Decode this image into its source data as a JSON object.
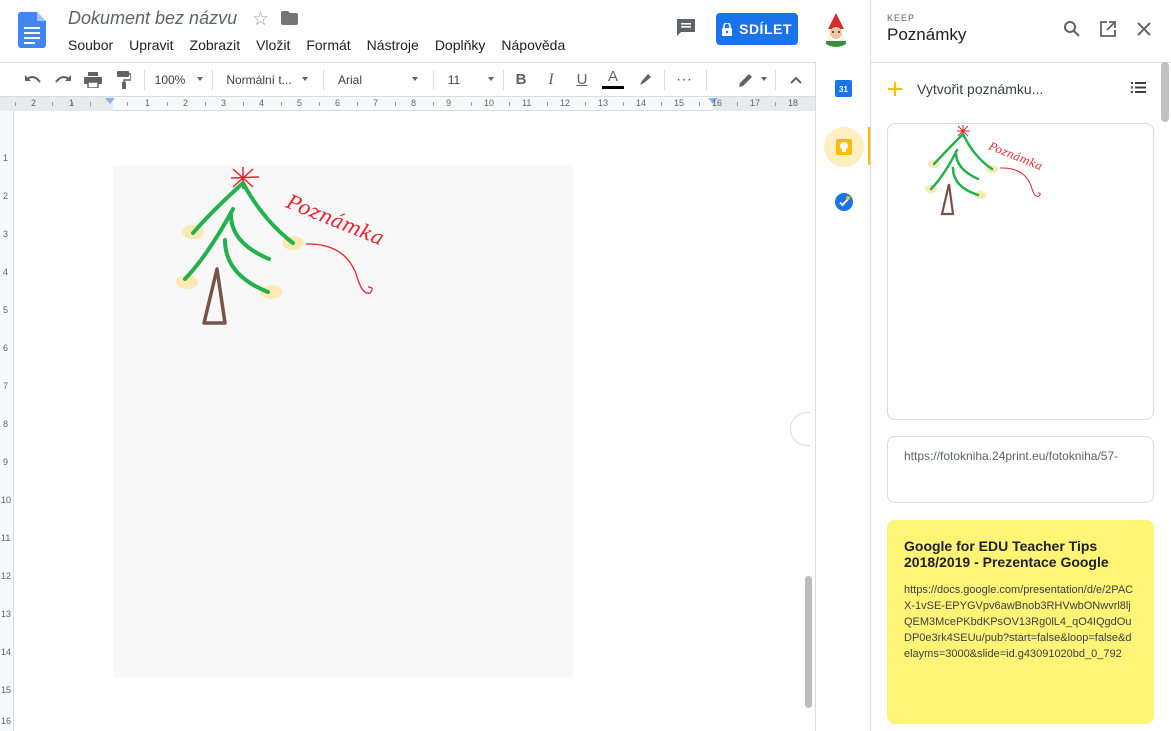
{
  "header": {
    "doc_title": "Dokument bez názvu",
    "share_label": "SDÍLET",
    "menu": [
      "Soubor",
      "Upravit",
      "Zobrazit",
      "Vložit",
      "Formát",
      "Nástroje",
      "Doplňky",
      "Nápověda"
    ]
  },
  "toolbar": {
    "zoom": "100%",
    "style": "Normální t...",
    "font": "Arial",
    "font_size": "11"
  },
  "ruler": {
    "labels": [
      "2",
      "1",
      "1",
      "2",
      "3",
      "4",
      "5",
      "6",
      "7",
      "8",
      "9",
      "10",
      "11",
      "12",
      "13",
      "14",
      "15",
      "16",
      "17",
      "18"
    ],
    "vlabels": [
      "1",
      "2",
      "3",
      "4",
      "5",
      "6",
      "7",
      "8",
      "9",
      "10",
      "11",
      "12",
      "13",
      "14",
      "15",
      "16"
    ]
  },
  "drawing": {
    "annotation": "Poznámka"
  },
  "rail": {
    "calendar_day": "31"
  },
  "keep": {
    "brand": "KEEP",
    "title": "Poznámky",
    "create_label": "Vytvořit poznámku...",
    "note1_annotation": "Poznámka",
    "note2_text": "https://fotokniha.24print.eu/fotokniha/57-",
    "note3_title": "Google for EDU Teacher Tips 2018/2019 - Prezentace Google",
    "note3_body": "https://docs.google.com/presentation/d/e/2PACX-1vSE-EPYGVpv6awBnob3RHVwbONwvrl8ljQEM3McePKbdKPsOV13Rg0lL4_qO4IQgdOuDP0e3rk4SEUu/pub?start=false&loop=false&delayms=3000&slide=id.g43091020bd_0_792",
    "note3_color": "#fff475"
  },
  "colors": {
    "share_blue": "#1a73e8",
    "tree_green": "#22b14c",
    "trunk_brown": "#7b5248",
    "annotation_red": "#e8222c",
    "keep_active": "#fbbc04"
  }
}
